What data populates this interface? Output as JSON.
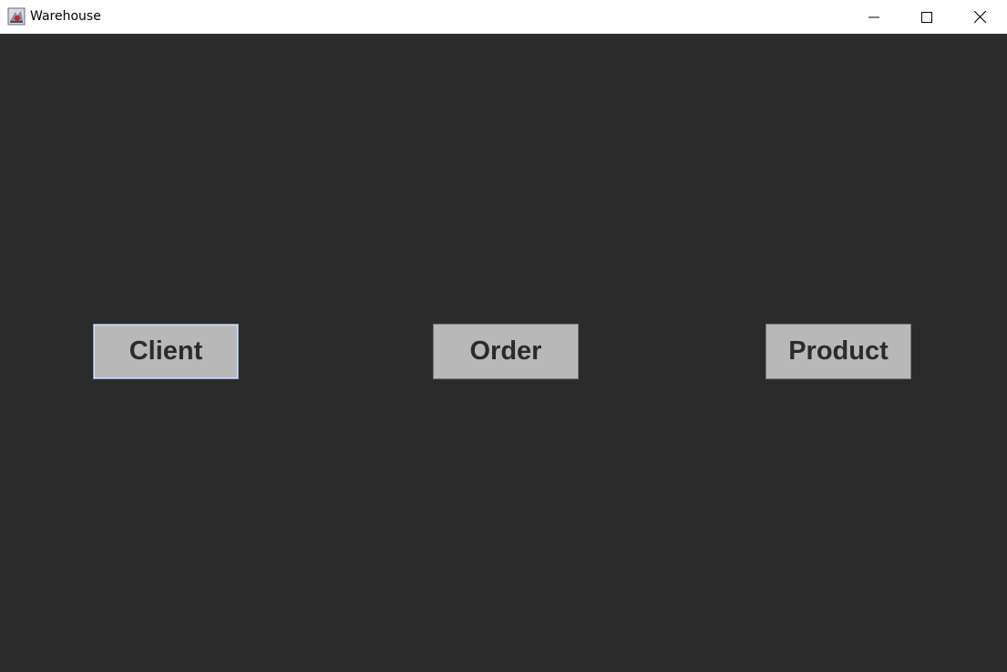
{
  "window": {
    "title": "Warehouse"
  },
  "icons": {
    "app": "java-app-icon",
    "minimize": "minimize-icon",
    "maximize": "maximize-icon",
    "close": "close-icon"
  },
  "colors": {
    "background": "#2b2b2b",
    "button_face": "#b8b8b8",
    "button_text": "#2b2b2b",
    "focus_border": "#7a9cc6"
  },
  "buttons": {
    "client_label": "Client",
    "order_label": "Order",
    "product_label": "Product"
  }
}
